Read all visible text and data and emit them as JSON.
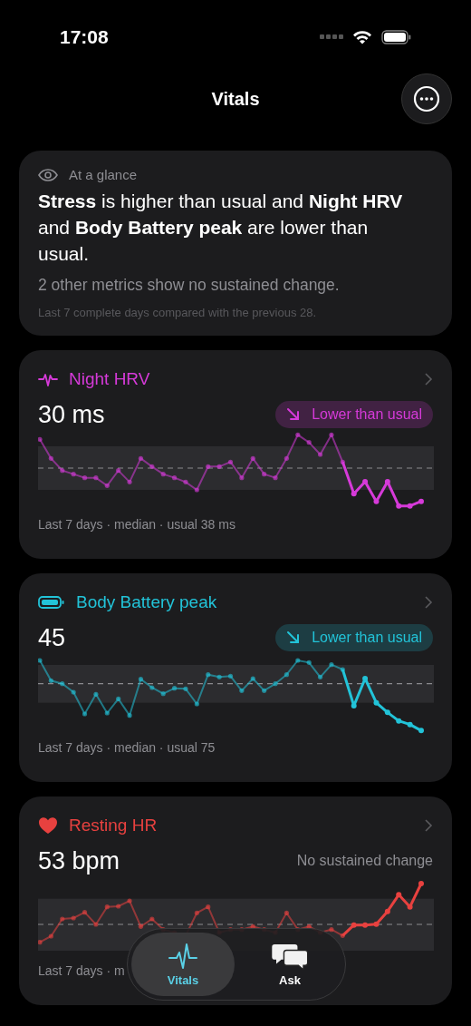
{
  "status_bar": {
    "time": "17:08"
  },
  "header": {
    "title": "Vitals"
  },
  "glance": {
    "label": "At a glance",
    "summary": "**Stress** is higher than usual and **Night HRV** and **Body Battery peak** are lower than usual.",
    "detail": "2 other metrics show no sustained change.",
    "note": "Last 7 complete days compared with the previous 28."
  },
  "metrics": [
    {
      "kind": "hrv",
      "title": "Night HRV",
      "color": "#d63ad9",
      "value": "30 ms",
      "status": {
        "kind": "badge",
        "text": "Lower than usual"
      },
      "footer": "Last 7 days · median · usual 38 ms"
    },
    {
      "kind": "battery",
      "title": "Body Battery peak",
      "color": "#22c3d8",
      "value": "45",
      "status": {
        "kind": "badge",
        "text": "Lower than usual"
      },
      "footer": "Last 7 days · median · usual 75"
    },
    {
      "kind": "heart",
      "title": "Resting HR",
      "color": "#e8413f",
      "value": "53 bpm",
      "status": {
        "kind": "plain",
        "text": "No sustained change"
      },
      "footer": "Last 7 days · m"
    }
  ],
  "tabs": [
    {
      "label": "Vitals",
      "kind": "pulse",
      "selected": true
    },
    {
      "label": "Ask",
      "kind": "chat",
      "selected": false
    }
  ]
}
